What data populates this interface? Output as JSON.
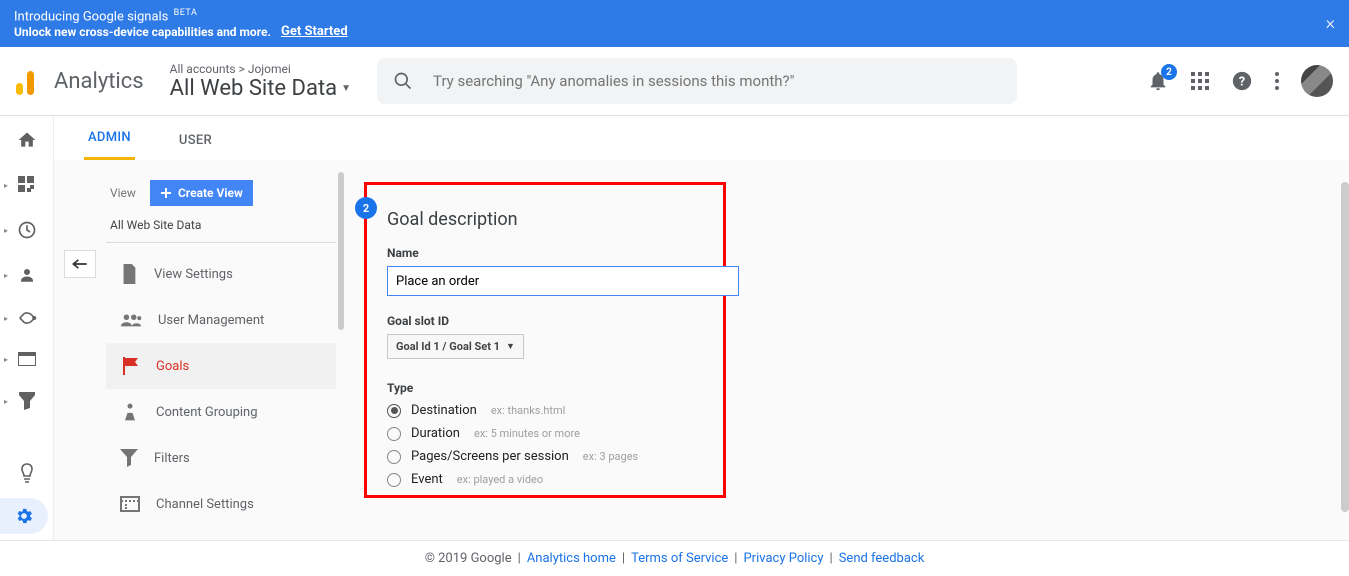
{
  "banner": {
    "intro": "Introducing Google signals",
    "beta": "BETA",
    "sub": "Unlock new cross-device capabilities and more.",
    "cta": "Get Started"
  },
  "header": {
    "product": "Analytics",
    "crumb_prefix": "All accounts",
    "crumb_sep": ">",
    "account": "Jojomei",
    "view": "All Web Site Data",
    "search_placeholder": "Try searching \"Any anomalies in sessions this month?\"",
    "notif_count": "2"
  },
  "tabs": {
    "admin": "ADMIN",
    "user": "USER"
  },
  "side": {
    "view_label": "View",
    "create_view": "Create View",
    "view_name": "All Web Site Data",
    "items": [
      {
        "label": "View Settings"
      },
      {
        "label": "User Management"
      },
      {
        "label": "Goals"
      },
      {
        "label": "Content Grouping"
      },
      {
        "label": "Filters"
      },
      {
        "label": "Channel Settings"
      }
    ]
  },
  "form": {
    "step": "2",
    "heading": "Goal description",
    "name_label": "Name",
    "name_value": "Place an order",
    "slot_label": "Goal slot ID",
    "slot_value": "Goal Id 1 / Goal Set 1",
    "type_label": "Type",
    "types": [
      {
        "label": "Destination",
        "hint": "ex: thanks.html"
      },
      {
        "label": "Duration",
        "hint": "ex: 5 minutes or more"
      },
      {
        "label": "Pages/Screens per session",
        "hint": "ex: 3 pages"
      },
      {
        "label": "Event",
        "hint": "ex: played a video"
      }
    ]
  },
  "footer": {
    "copyright": "© 2019 Google",
    "links": [
      "Analytics home",
      "Terms of Service",
      "Privacy Policy",
      "Send feedback"
    ]
  }
}
